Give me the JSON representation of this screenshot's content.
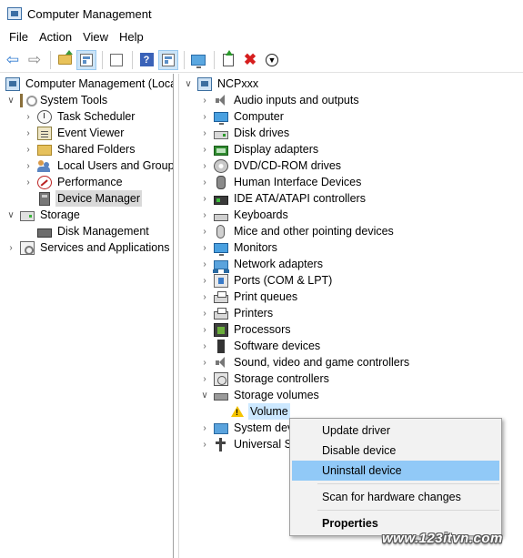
{
  "window": {
    "title": "Computer Management"
  },
  "menubar": {
    "items": [
      "File",
      "Action",
      "View",
      "Help"
    ]
  },
  "toolbar": {
    "icons": [
      "back-arrow-icon",
      "forward-arrow-icon",
      "up-folder-icon",
      "show-hide-console-tree-icon",
      "properties-icon",
      "help-icon",
      "action-pane-icon",
      "scan-hardware-icon",
      "update-driver-icon",
      "uninstall-x-icon",
      "disable-device-icon"
    ]
  },
  "left_tree": {
    "root": "Computer Management (Local",
    "items": [
      {
        "label": "System Tools",
        "icon": "tools-icon"
      },
      {
        "label": "Task Scheduler",
        "icon": "clock-icon"
      },
      {
        "label": "Event Viewer",
        "icon": "event-log-icon"
      },
      {
        "label": "Shared Folders",
        "icon": "shared-folder-icon"
      },
      {
        "label": "Local Users and Groups",
        "icon": "users-icon"
      },
      {
        "label": "Performance",
        "icon": "performance-icon"
      },
      {
        "label": "Device Manager",
        "icon": "device-manager-icon"
      },
      {
        "label": "Storage",
        "icon": "storage-icon"
      },
      {
        "label": "Disk Management",
        "icon": "disk-icon"
      },
      {
        "label": "Services and Applications",
        "icon": "services-icon"
      }
    ]
  },
  "device_tree": {
    "root": "NCPxxx",
    "categories": [
      "Audio inputs and outputs",
      "Computer",
      "Disk drives",
      "Display adapters",
      "DVD/CD-ROM drives",
      "Human Interface Devices",
      "IDE ATA/ATAPI controllers",
      "Keyboards",
      "Mice and other pointing devices",
      "Monitors",
      "Network adapters",
      "Ports (COM & LPT)",
      "Print queues",
      "Printers",
      "Processors",
      "Software devices",
      "Sound, video and game controllers",
      "Storage controllers",
      "Storage volumes",
      "Volume",
      "System dev",
      "Universal Se"
    ]
  },
  "context_menu": {
    "items": [
      "Update driver",
      "Disable device",
      "Uninstall device",
      "Scan for hardware changes",
      "Properties"
    ],
    "highlighted": "Uninstall device"
  },
  "watermark": "www.123itvn.com",
  "colors": {
    "selection": "#cce8ff",
    "menu_hover": "#91c9f7",
    "tree_selected": "#d9d9d9"
  }
}
